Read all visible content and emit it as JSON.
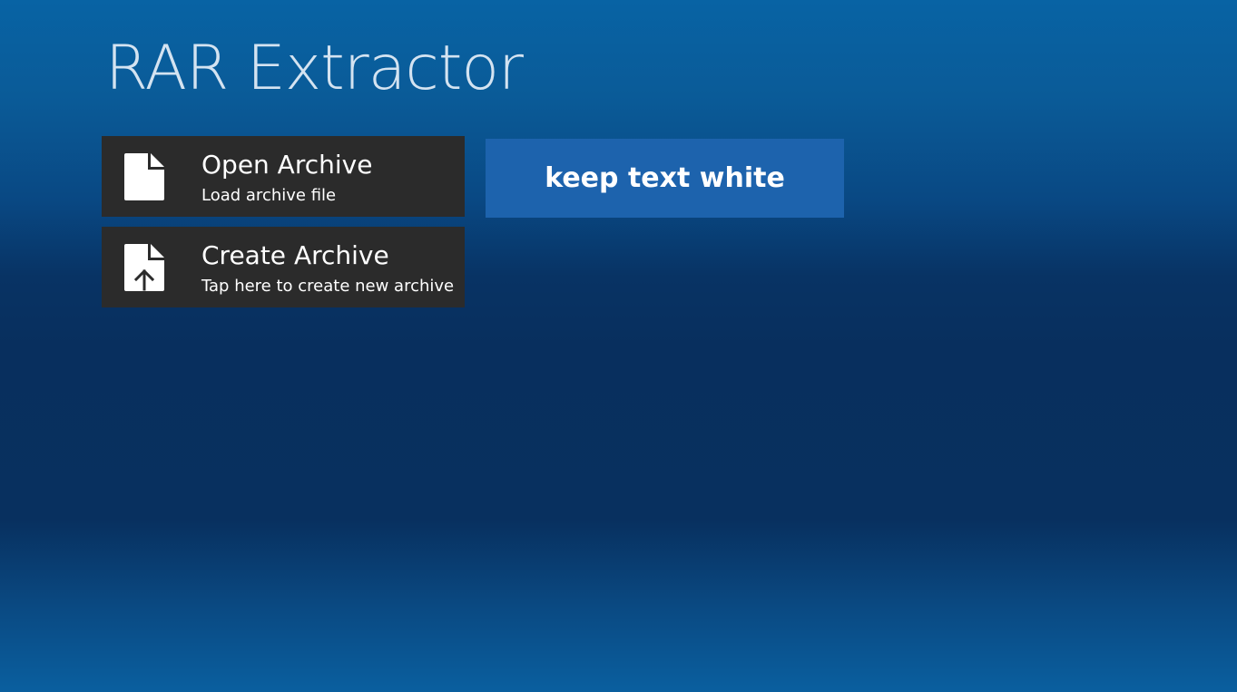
{
  "app": {
    "title": "RAR Extractor"
  },
  "tiles": [
    {
      "title": "Open Archive",
      "subtitle": "Load archive file",
      "icon": "document-icon"
    },
    {
      "title": "Create Archive",
      "subtitle": "Tap here to create new archive",
      "icon": "document-upload-icon"
    }
  ],
  "action_button": {
    "label": "keep text white"
  },
  "colors": {
    "background_top": "#0863a4",
    "background_mid": "#082f5e",
    "tile_background": "#2b2b2b",
    "button_background": "#1d63ad",
    "title_color": "#d4e3f1"
  }
}
